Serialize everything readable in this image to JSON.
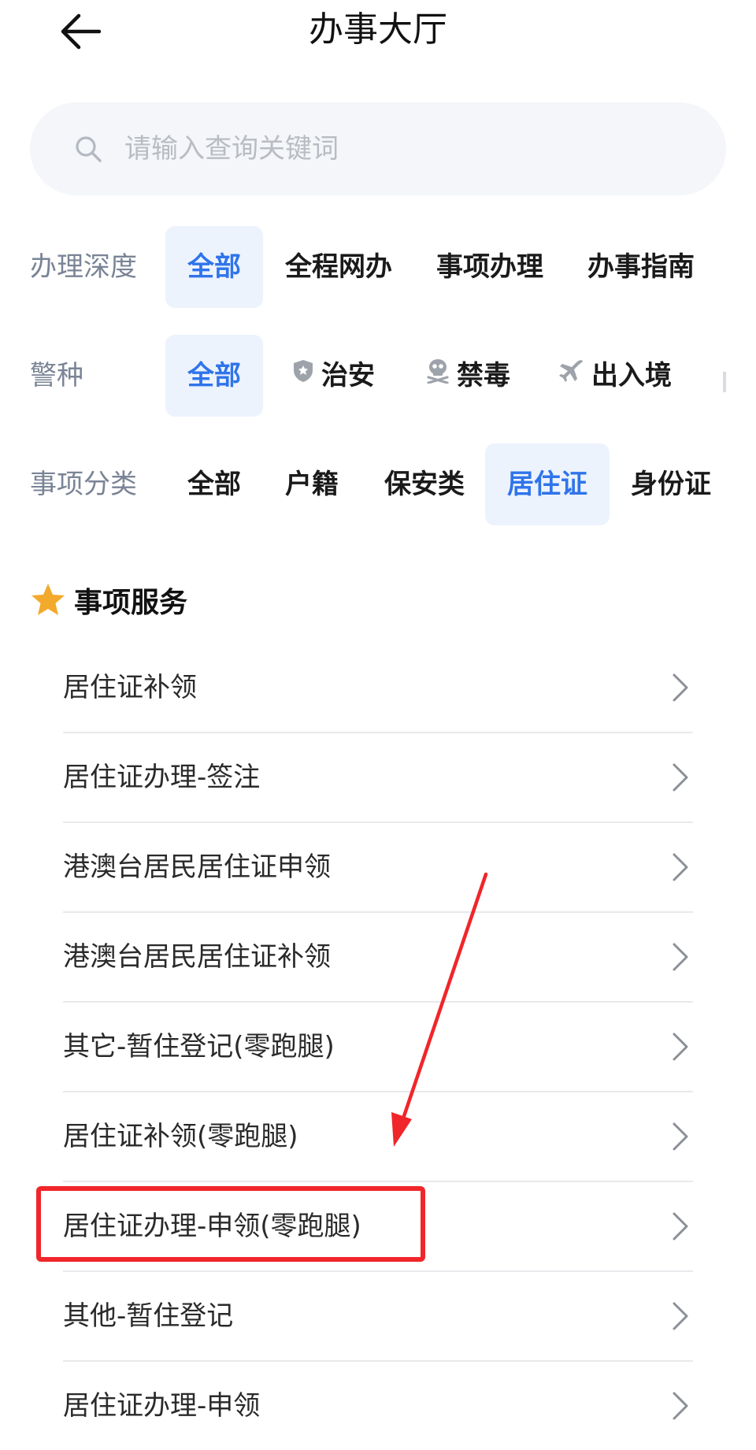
{
  "header": {
    "title": "办事大厅"
  },
  "search": {
    "placeholder": "请输入查询关键词"
  },
  "filters": {
    "depth": {
      "label": "办理深度",
      "options": [
        "全部",
        "全程网办",
        "事项办理",
        "办事指南"
      ],
      "selected": "全部"
    },
    "police_type": {
      "label": "警种",
      "options": [
        {
          "label": "全部",
          "icon": ""
        },
        {
          "label": "治安",
          "icon": "shield-icon"
        },
        {
          "label": "禁毒",
          "icon": "skull-icon"
        },
        {
          "label": "出入境",
          "icon": "airplane-icon"
        }
      ],
      "selected": "全部"
    },
    "category": {
      "label": "事项分类",
      "options": [
        "全部",
        "户籍",
        "保安类",
        "居住证",
        "身份证"
      ],
      "selected": "居住证"
    }
  },
  "section": {
    "title": "事项服务",
    "icon": "star-icon"
  },
  "services": [
    "居住证补领",
    "居住证办理-签注",
    "港澳台居民居住证申领",
    "港澳台居民居住证补领",
    "其它-暂住登记(零跑腿)",
    "居住证补领(零跑腿)",
    "居住证办理-申领(零跑腿)",
    "其他-暂住登记",
    "居住证办理-申领"
  ],
  "colors": {
    "accent": "#2f74ea",
    "chip_active_bg": "#edf3fd",
    "label_gray": "#7a8496",
    "star": "#f3a92b",
    "annotation_red": "#f0262a"
  }
}
